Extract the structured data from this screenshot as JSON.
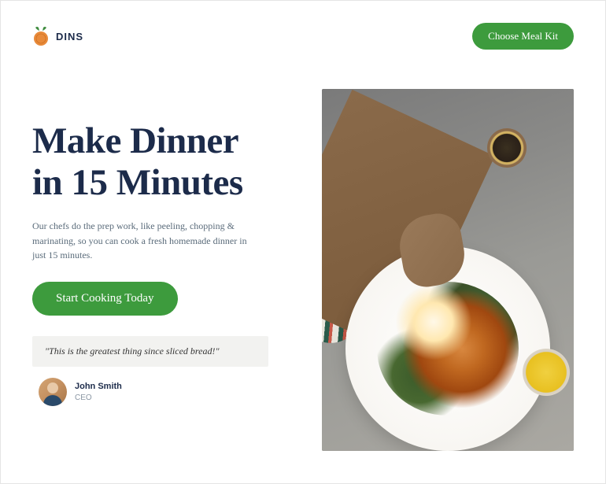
{
  "brand": {
    "name": "DINS",
    "icon": "orange-fruit-icon",
    "colors": {
      "accent": "#3d9b3d",
      "text_dark": "#1c2b4a",
      "leaf": "#3d8b3d",
      "orange": "#e88a3a"
    }
  },
  "header": {
    "choose_button_label": "Choose Meal Kit"
  },
  "hero": {
    "headline": "Make Dinner in 15 Minutes",
    "subtext": "Our chefs do the prep work, like peeling, chopping & marinating, so you can cook a fresh homemade dinner in just 15 minutes.",
    "cta_label": "Start Cooking Today",
    "image_description": "Overhead view of hands with a gold watch holding a fork over a white plate of salad with egg and roasted toppings on a marble table"
  },
  "testimonial": {
    "quote": "\"This is the greatest thing since sliced bread!\"",
    "author_name": "John Smith",
    "author_role": "CEO"
  }
}
